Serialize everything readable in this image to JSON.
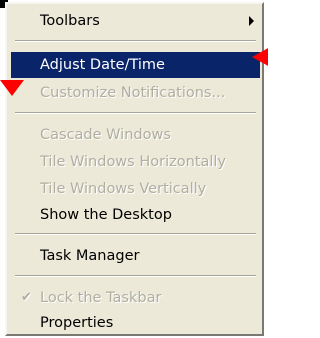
{
  "menu": {
    "items": [
      {
        "label": "Toolbars",
        "state": "enabled",
        "submenu": true
      },
      {
        "label": "Adjust Date/Time",
        "state": "selected"
      },
      {
        "label": "Customize Notifications...",
        "state": "disabled"
      },
      {
        "label": "Cascade Windows",
        "state": "disabled"
      },
      {
        "label": "Tile Windows Horizontally",
        "state": "disabled"
      },
      {
        "label": "Tile Windows Vertically",
        "state": "disabled"
      },
      {
        "label": "Show the Desktop",
        "state": "enabled"
      },
      {
        "label": "Task Manager",
        "state": "enabled"
      },
      {
        "label": "Lock the Taskbar",
        "state": "disabled",
        "checked": true
      },
      {
        "label": "Properties",
        "state": "enabled"
      }
    ]
  },
  "colors": {
    "menu_background": "#ece9d8",
    "selection": "#0a246a",
    "disabled_text": "#b0aea1",
    "annotation_pointer": "#ff0000"
  },
  "icons": {
    "submenu": "submenu-arrow-icon",
    "check": "check-icon"
  }
}
